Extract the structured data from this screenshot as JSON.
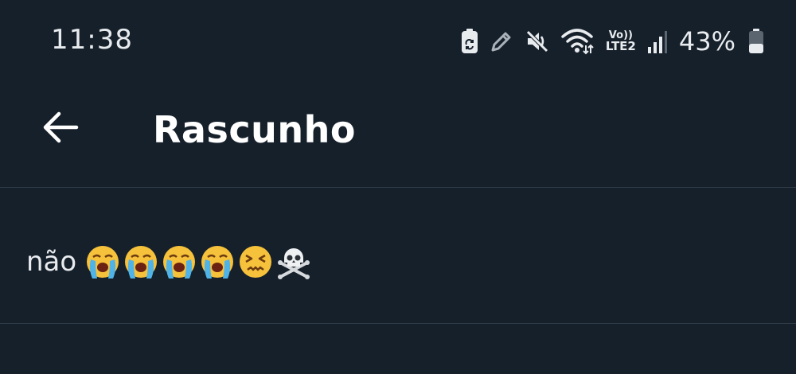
{
  "status_bar": {
    "time": "11:38",
    "battery_percent": "43%",
    "network_label": "LTE2",
    "volte_label": "Vo))",
    "icons": [
      "battery-saver-icon",
      "pen-icon",
      "mute-icon",
      "wifi-icon",
      "volte-lte2-icon",
      "signal-icon",
      "battery-icon"
    ],
    "battery_level": 0.43
  },
  "header": {
    "back_icon": "arrow-left-icon",
    "title": "Rascunho"
  },
  "drafts": [
    {
      "text": "não",
      "emojis": [
        "loudly-crying-face",
        "loudly-crying-face",
        "loudly-crying-face",
        "loudly-crying-face",
        "confounded-face",
        "skull-and-crossbones"
      ]
    }
  ],
  "colors": {
    "background": "#16202b",
    "divider": "#2f3b47",
    "text": "#e9ecef"
  }
}
